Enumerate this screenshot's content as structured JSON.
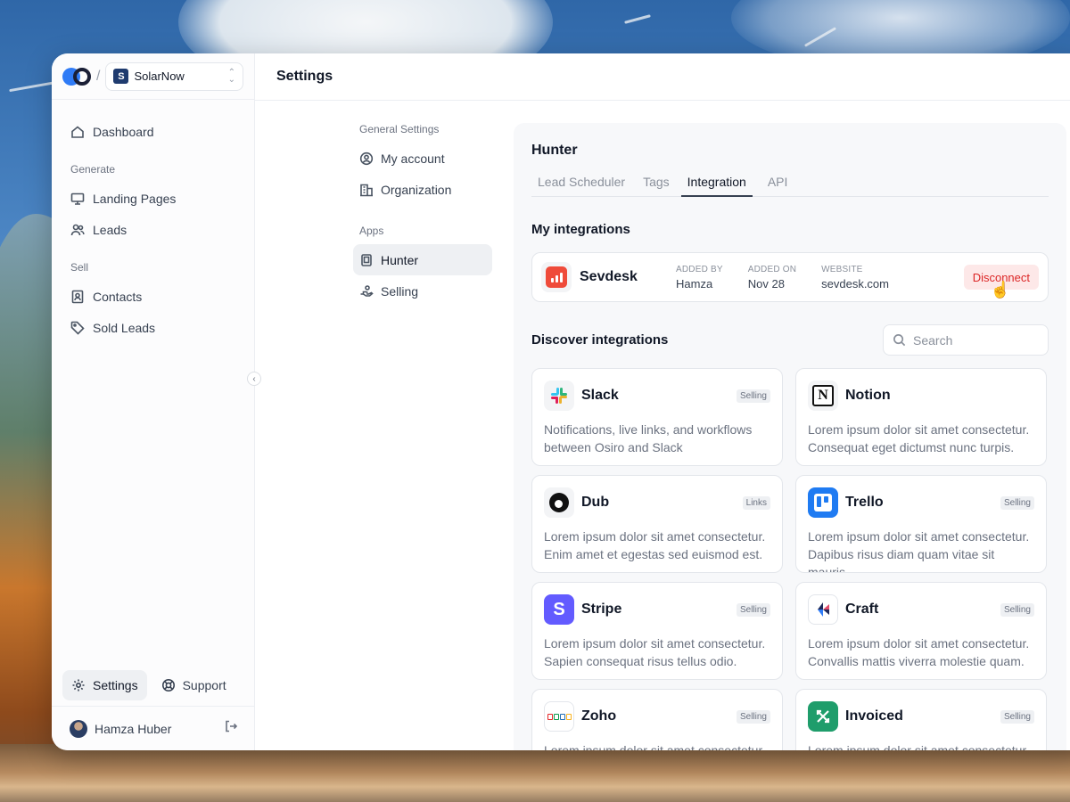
{
  "workspace": {
    "name": "SolarNow",
    "badge": "S"
  },
  "sidebar": {
    "items": [
      {
        "label": "Dashboard"
      }
    ],
    "sections": [
      {
        "title": "Generate",
        "items": [
          {
            "label": "Landing Pages"
          },
          {
            "label": "Leads"
          }
        ]
      },
      {
        "title": "Sell",
        "items": [
          {
            "label": "Contacts"
          },
          {
            "label": "Sold Leads"
          }
        ]
      }
    ],
    "bottom": {
      "settings_label": "Settings",
      "support_label": "Support"
    },
    "user": {
      "name": "Hamza Huber"
    }
  },
  "header": {
    "title": "Settings"
  },
  "settings_nav": {
    "general_title": "General Settings",
    "general_items": [
      {
        "label": "My account"
      },
      {
        "label": "Organization"
      }
    ],
    "apps_title": "Apps",
    "apps_items": [
      {
        "label": "Hunter"
      },
      {
        "label": "Selling"
      }
    ]
  },
  "panel": {
    "title": "Hunter",
    "tabs": [
      {
        "label": "Lead Scheduler"
      },
      {
        "label": "Tags"
      },
      {
        "label": "Integration"
      },
      {
        "label": "API"
      }
    ],
    "active_tab": "Integration",
    "my_integrations_title": "My integrations",
    "my_integration": {
      "name": "Sevdesk",
      "added_by_label": "ADDED BY",
      "added_by": "Hamza",
      "added_on_label": "ADDED ON",
      "added_on": "Nov 28",
      "website_label": "WEBSITE",
      "website": "sevdesk.com",
      "action": "Disconnect"
    },
    "discover_title": "Discover integrations",
    "search_placeholder": "Search",
    "integrations": [
      {
        "name": "Slack",
        "badge": "Selling",
        "desc": "Notifications, live links, and workflows between Osiro and Slack"
      },
      {
        "name": "Notion",
        "badge": "",
        "desc": "Lorem ipsum dolor sit amet consectetur. Consequat eget dictumst nunc turpis."
      },
      {
        "name": "Dub",
        "badge": "Links",
        "desc": "Lorem ipsum dolor sit amet consectetur. Enim amet et egestas sed euismod est."
      },
      {
        "name": "Trello",
        "badge": "Selling",
        "desc": "Lorem ipsum dolor sit amet consectetur. Dapibus risus diam quam vitae sit mauris."
      },
      {
        "name": "Stripe",
        "badge": "Selling",
        "desc": "Lorem ipsum dolor sit amet consectetur. Sapien consequat risus tellus odio."
      },
      {
        "name": "Craft",
        "badge": "Selling",
        "desc": "Lorem ipsum dolor sit amet consectetur. Convallis mattis viverra molestie quam."
      },
      {
        "name": "Zoho",
        "badge": "Selling",
        "desc": "Lorem ipsum dolor sit amet consectetur."
      },
      {
        "name": "Invoiced",
        "badge": "Selling",
        "desc": "Lorem ipsum dolor sit amet consectetur."
      }
    ]
  },
  "colors": {
    "accent": "#2f7bf6",
    "danger": "#dc2626",
    "danger_bg": "#fde8e8"
  }
}
